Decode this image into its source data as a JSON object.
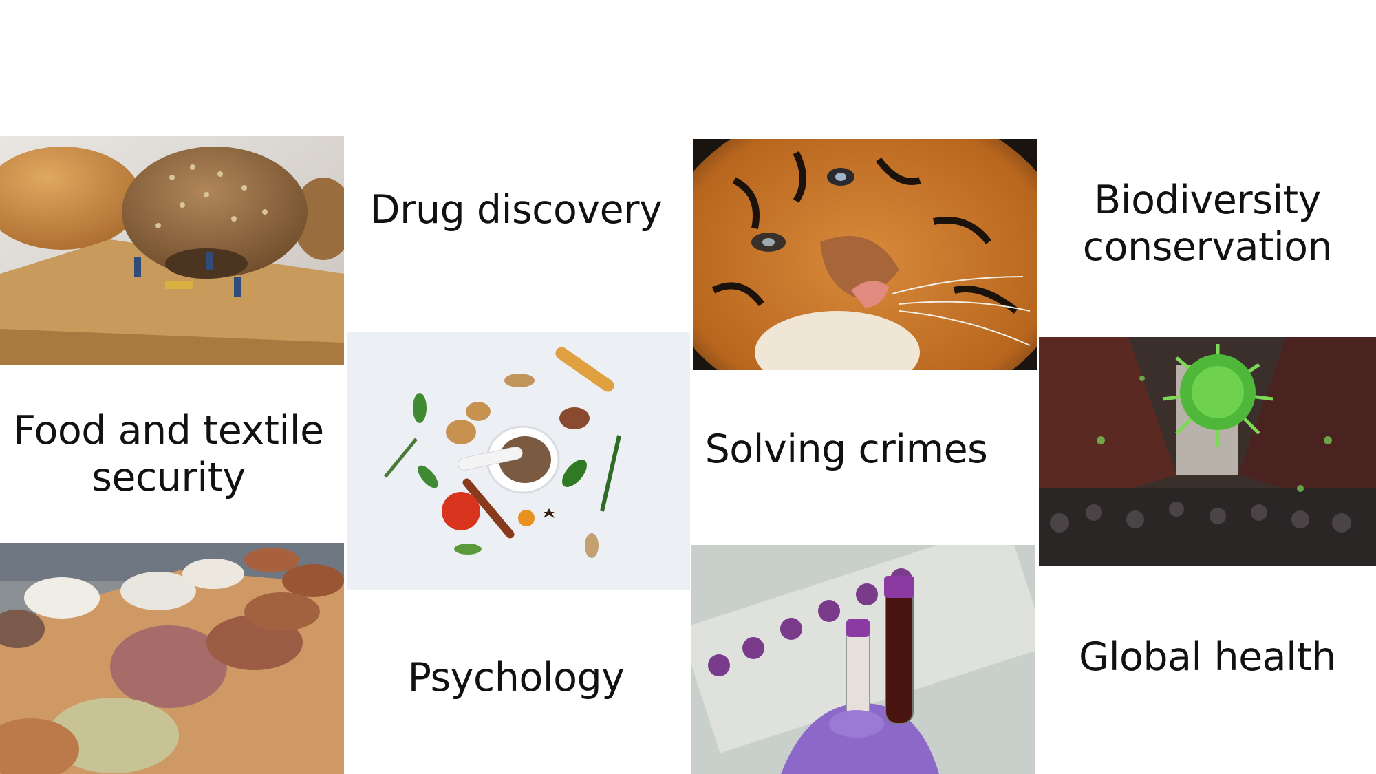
{
  "labels": {
    "drug_discovery": "Drug discovery",
    "biodiversity_conservation": "Biodiversity\nconservation",
    "food_textile_security": "Food and textile\nsecurity",
    "solving_crimes": "Solving crimes",
    "psychology": "Psychology",
    "global_health": "Global health"
  },
  "colors": {
    "background": "#ffffff",
    "text": "#111111"
  }
}
